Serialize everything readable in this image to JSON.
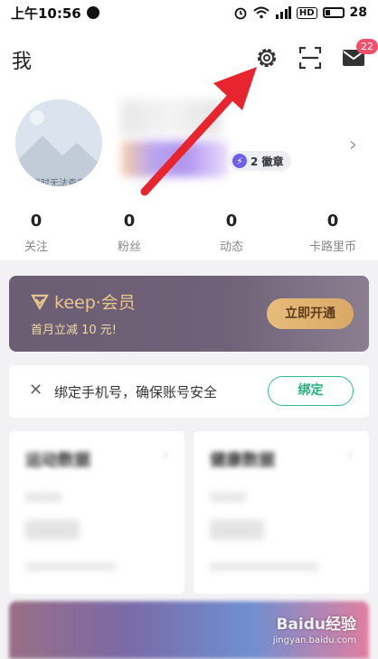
{
  "status_bar": {
    "time": "上午10:56",
    "battery": "28",
    "network": "4G",
    "hd": "HD"
  },
  "header": {
    "title": "我",
    "settings_icon": "gear-icon",
    "scan_icon": "scan-icon",
    "mail_icon": "mail-icon",
    "mail_badge": "22"
  },
  "profile": {
    "avatar_text": "暂时无法查看",
    "medal_count_label": "2 徽章",
    "stats": [
      {
        "value": "0",
        "label": "关注"
      },
      {
        "value": "0",
        "label": "粉丝"
      },
      {
        "value": "0",
        "label": "动态"
      },
      {
        "value": "0",
        "label": "卡路里币"
      }
    ]
  },
  "vip": {
    "logo_text": "keep·会员",
    "subtitle": "首月立减 10 元!",
    "button": "立即开通"
  },
  "bind_phone": {
    "text": "绑定手机号，确保账号安全",
    "button": "绑定"
  },
  "cards": {
    "left_title": "运动数据",
    "right_title": "健康数据"
  },
  "watermark": {
    "brand": "Baidu经验",
    "url": "jingyan.baidu.com"
  },
  "colors": {
    "accent_green": "#22b07a",
    "vip_gold": "#e9c68b",
    "badge_red": "#f0506a",
    "annotation_arrow": "#e8252e"
  }
}
